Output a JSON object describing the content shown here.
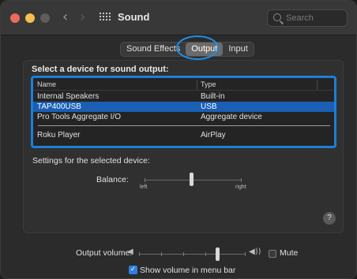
{
  "window": {
    "title": "Sound"
  },
  "toolbar": {
    "back_icon": "‹",
    "forward_icon": "›",
    "search_placeholder": "Search"
  },
  "tabs": [
    {
      "label": "Sound Effects",
      "selected": false
    },
    {
      "label": "Output",
      "selected": true
    },
    {
      "label": "Input",
      "selected": false
    }
  ],
  "output": {
    "heading": "Select a device for sound output:",
    "columns": {
      "name": "Name",
      "type": "Type"
    },
    "devices": [
      {
        "name": "Internal Speakers",
        "type": "Built-in",
        "selected": false
      },
      {
        "name": "TAP400USB",
        "type": "USB",
        "selected": true
      },
      {
        "name": "Pro Tools Aggregate I/O",
        "type": "Aggregate device",
        "selected": false
      },
      {
        "name": "Roku Player",
        "type": "AirPlay",
        "selected": false
      }
    ],
    "settings_label": "Settings for the selected device:",
    "balance": {
      "label": "Balance:",
      "left": "left",
      "right": "right",
      "value": 0.5
    },
    "help_label": "?"
  },
  "footer": {
    "output_volume_label": "Output volume:",
    "volume_value": 0.75,
    "mute_label": "Mute",
    "mute_checked": false,
    "show_volume_label": "Show volume in menu bar",
    "show_volume_checked": true
  },
  "colors": {
    "accent": "#1d7fd6",
    "selection": "#1a5fb4",
    "close": "#ed6a5e",
    "minimize": "#f5bf4f"
  }
}
